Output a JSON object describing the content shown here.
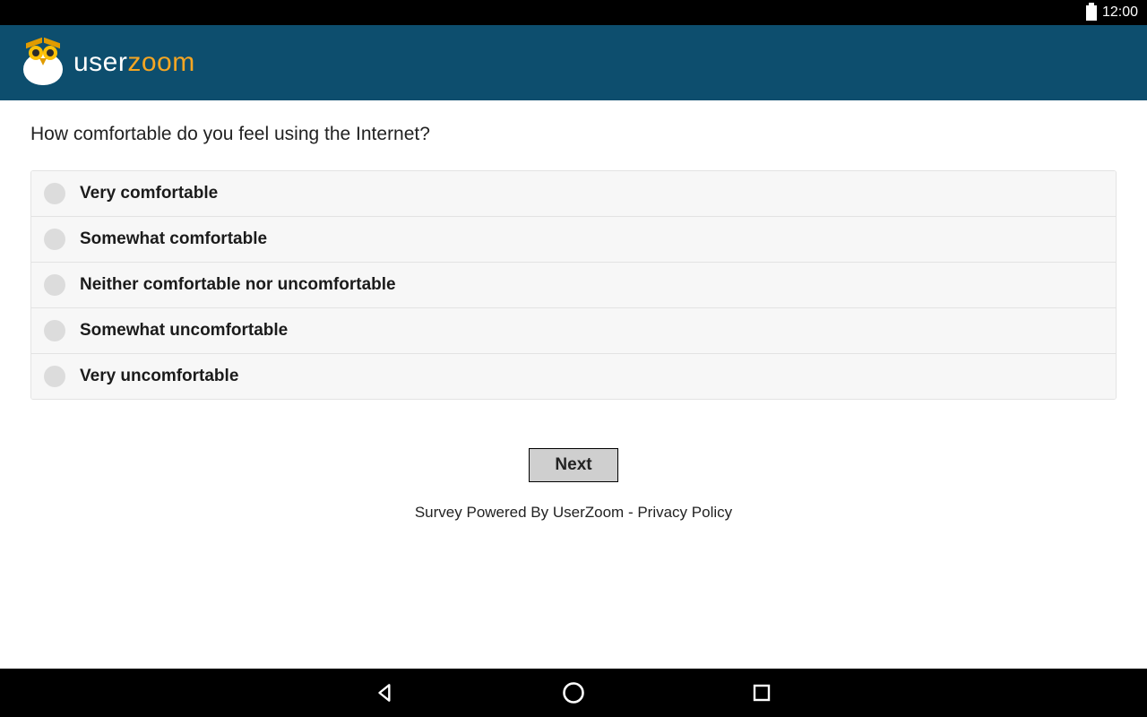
{
  "status": {
    "time": "12:00"
  },
  "brand": {
    "part1": "user",
    "part2": "zoom"
  },
  "survey": {
    "question": "How comfortable do you feel using the Internet?",
    "options": [
      "Very comfortable",
      "Somewhat comfortable",
      "Neither comfortable nor uncomfortable",
      "Somewhat uncomfortable",
      "Very uncomfortable"
    ],
    "next_label": "Next"
  },
  "footer": {
    "powered_by": "Survey Powered By UserZoom",
    "separator": " - ",
    "privacy": "Privacy Policy"
  }
}
